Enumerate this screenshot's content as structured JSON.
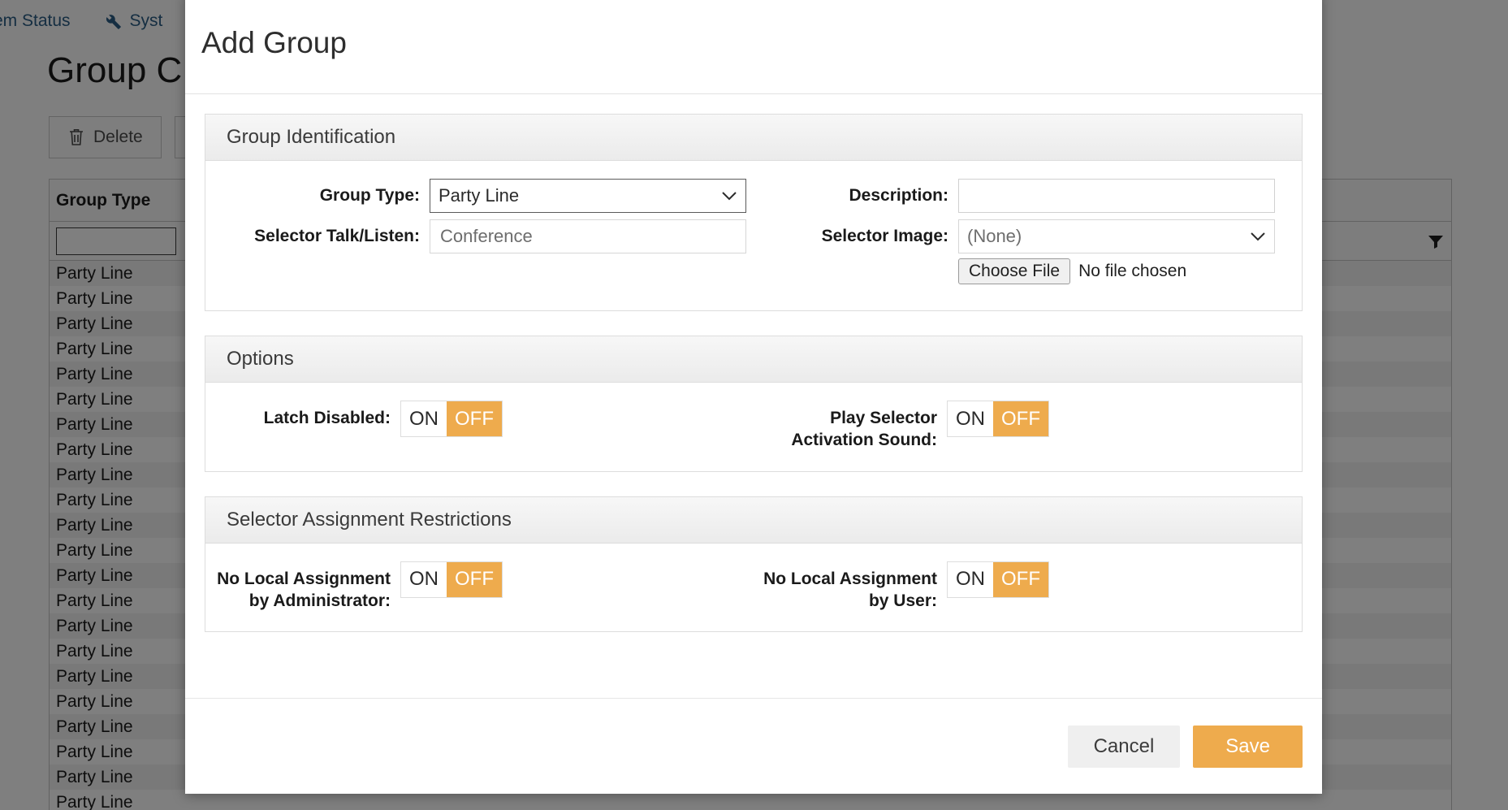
{
  "background": {
    "nav": [
      {
        "label": "em Status",
        "icon": ""
      },
      {
        "label": "Syst",
        "icon": "wrench-icon"
      }
    ],
    "page_title": "Group C",
    "toolbar": [
      {
        "label": "Delete",
        "icon": "trash-icon"
      },
      {
        "label": "",
        "icon": ""
      }
    ],
    "table": {
      "columns": [
        "Group Type",
        ""
      ],
      "filter_values": [
        "",
        ""
      ],
      "rows": [
        "Party Line",
        "Party Line",
        "Party Line",
        "Party Line",
        "Party Line",
        "Party Line",
        "Party Line",
        "Party Line",
        "Party Line",
        "Party Line",
        "Party Line",
        "Party Line",
        "Party Line",
        "Party Line",
        "Party Line",
        "Party Line",
        "Party Line",
        "Party Line",
        "Party Line",
        "Party Line",
        "Party Line",
        "Party Line"
      ]
    }
  },
  "modal": {
    "title": "Add Group",
    "sections": {
      "identification": {
        "title": "Group Identification",
        "group_type": {
          "label": "Group Type:",
          "value": "Party Line",
          "options": [
            "Party Line"
          ]
        },
        "selector_talk_listen": {
          "label": "Selector Talk/Listen:",
          "value": "",
          "placeholder": "Conference"
        },
        "description": {
          "label": "Description:",
          "value": "",
          "placeholder": ""
        },
        "selector_image": {
          "label": "Selector Image:",
          "value": "(None)",
          "options": [
            "(None)"
          ],
          "choose_file_label": "Choose File",
          "file_status": "No file chosen"
        }
      },
      "options": {
        "title": "Options",
        "latch_disabled": {
          "label": "Latch Disabled:",
          "on_label": "ON",
          "off_label": "OFF",
          "selected": "OFF"
        },
        "play_selector_activation_sound": {
          "label": "Play Selector Activation Sound:",
          "on_label": "ON",
          "off_label": "OFF",
          "selected": "OFF"
        }
      },
      "restrictions": {
        "title": "Selector Assignment Restrictions",
        "no_local_assignment_admin": {
          "label": "No Local Assignment by Administrator:",
          "on_label": "ON",
          "off_label": "OFF",
          "selected": "OFF"
        },
        "no_local_assignment_user": {
          "label": "No Local Assignment by User:",
          "on_label": "ON",
          "off_label": "OFF",
          "selected": "OFF"
        }
      }
    },
    "footer": {
      "cancel_label": "Cancel",
      "save_label": "Save"
    }
  },
  "colors": {
    "accent_orange": "#eeab4d",
    "link_blue": "#2a5d85",
    "scrim": "rgba(0,0,0,0.5)"
  }
}
